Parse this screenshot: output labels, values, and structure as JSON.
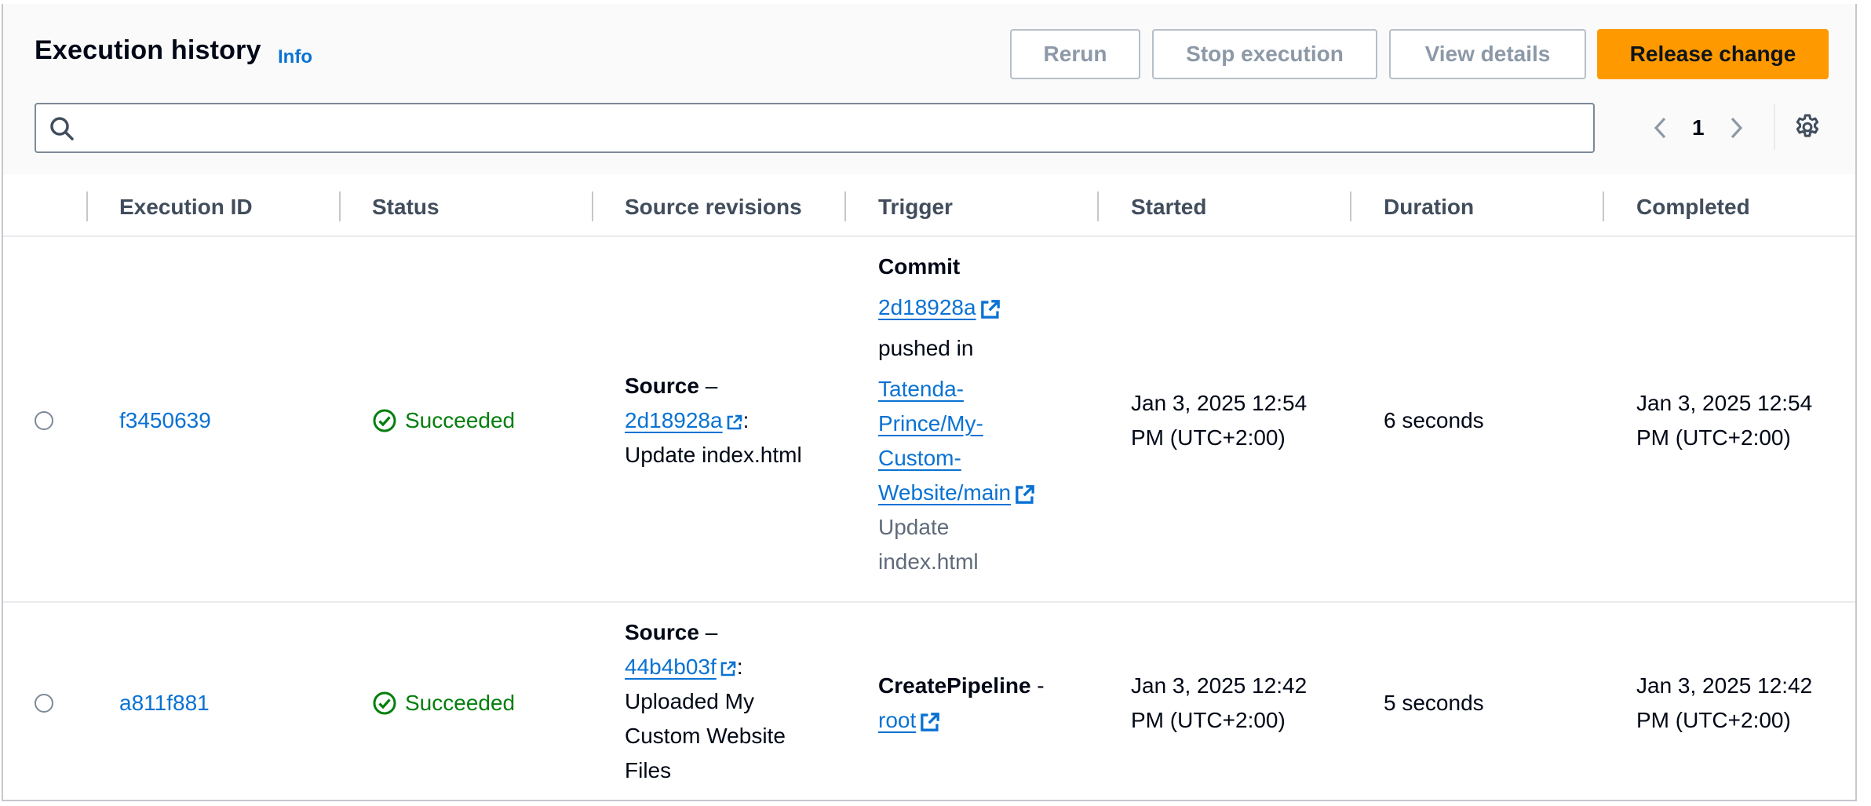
{
  "header": {
    "title": "Execution history",
    "info_label": "Info",
    "buttons": {
      "rerun": "Rerun",
      "stop": "Stop execution",
      "view": "View details",
      "release": "Release change"
    },
    "search": {
      "value": "",
      "placeholder": ""
    },
    "pagination": {
      "current_page": "1"
    }
  },
  "columns": [
    "Execution ID",
    "Status",
    "Source revisions",
    "Trigger",
    "Started",
    "Duration",
    "Completed"
  ],
  "rows": [
    {
      "execution_id": "f3450639",
      "status": "Succeeded",
      "source": {
        "label": "Source",
        "sep": " –",
        "revision": "2d18928a",
        "colon": ":",
        "message": "Update index.html"
      },
      "trigger": {
        "type": "Commit",
        "commit_id": "2d18928a",
        "pushed_in": "pushed in",
        "repo_line1": "Tatenda-",
        "repo_line2": "Prince/My-",
        "repo_line3": "Custom-",
        "repo_line4": "Website/main",
        "message_line1": "Update",
        "message_line2": "index.html"
      },
      "started_line1": "Jan 3, 2025 12:54",
      "started_line2": "PM (UTC+2:00)",
      "duration": "6 seconds",
      "completed_line1": "Jan 3, 2025 12:54",
      "completed_line2": "PM (UTC+2:00)"
    },
    {
      "execution_id": "a811f881",
      "status": "Succeeded",
      "source": {
        "label": "Source",
        "sep": " –",
        "revision": "44b4b03f",
        "colon": ":",
        "message_line1": "Uploaded My",
        "message_line2": "Custom Website",
        "message_line3": "Files"
      },
      "trigger": {
        "type": "CreatePipeline",
        "sep": " -",
        "user": "root"
      },
      "started_line1": "Jan 3, 2025 12:42",
      "started_line2": "PM (UTC+2:00)",
      "duration": "5 seconds",
      "completed_line1": "Jan 3, 2025 12:42",
      "completed_line2": "PM (UTC+2:00)"
    }
  ]
}
